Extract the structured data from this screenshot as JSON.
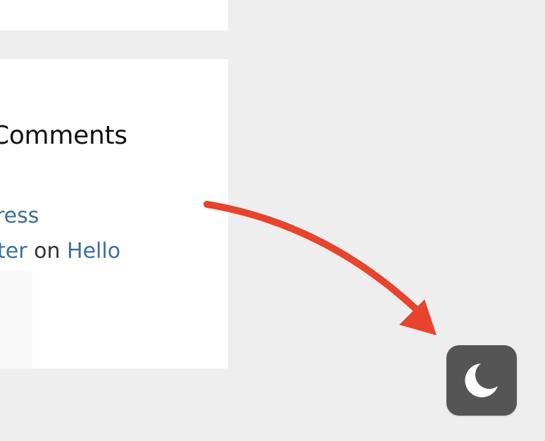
{
  "comments_widget": {
    "heading": "Comments",
    "entry_1": {
      "link_text": "ress"
    },
    "entry_2": {
      "author_link": "ter",
      "separator": "on",
      "post_link": "Hello"
    }
  },
  "dark_mode_toggle": {
    "icon": "moon-icon",
    "background": "#555555",
    "icon_color": "#ffffff"
  },
  "annotation": {
    "icon": "arrow-annotation",
    "color": "#e8432d"
  }
}
